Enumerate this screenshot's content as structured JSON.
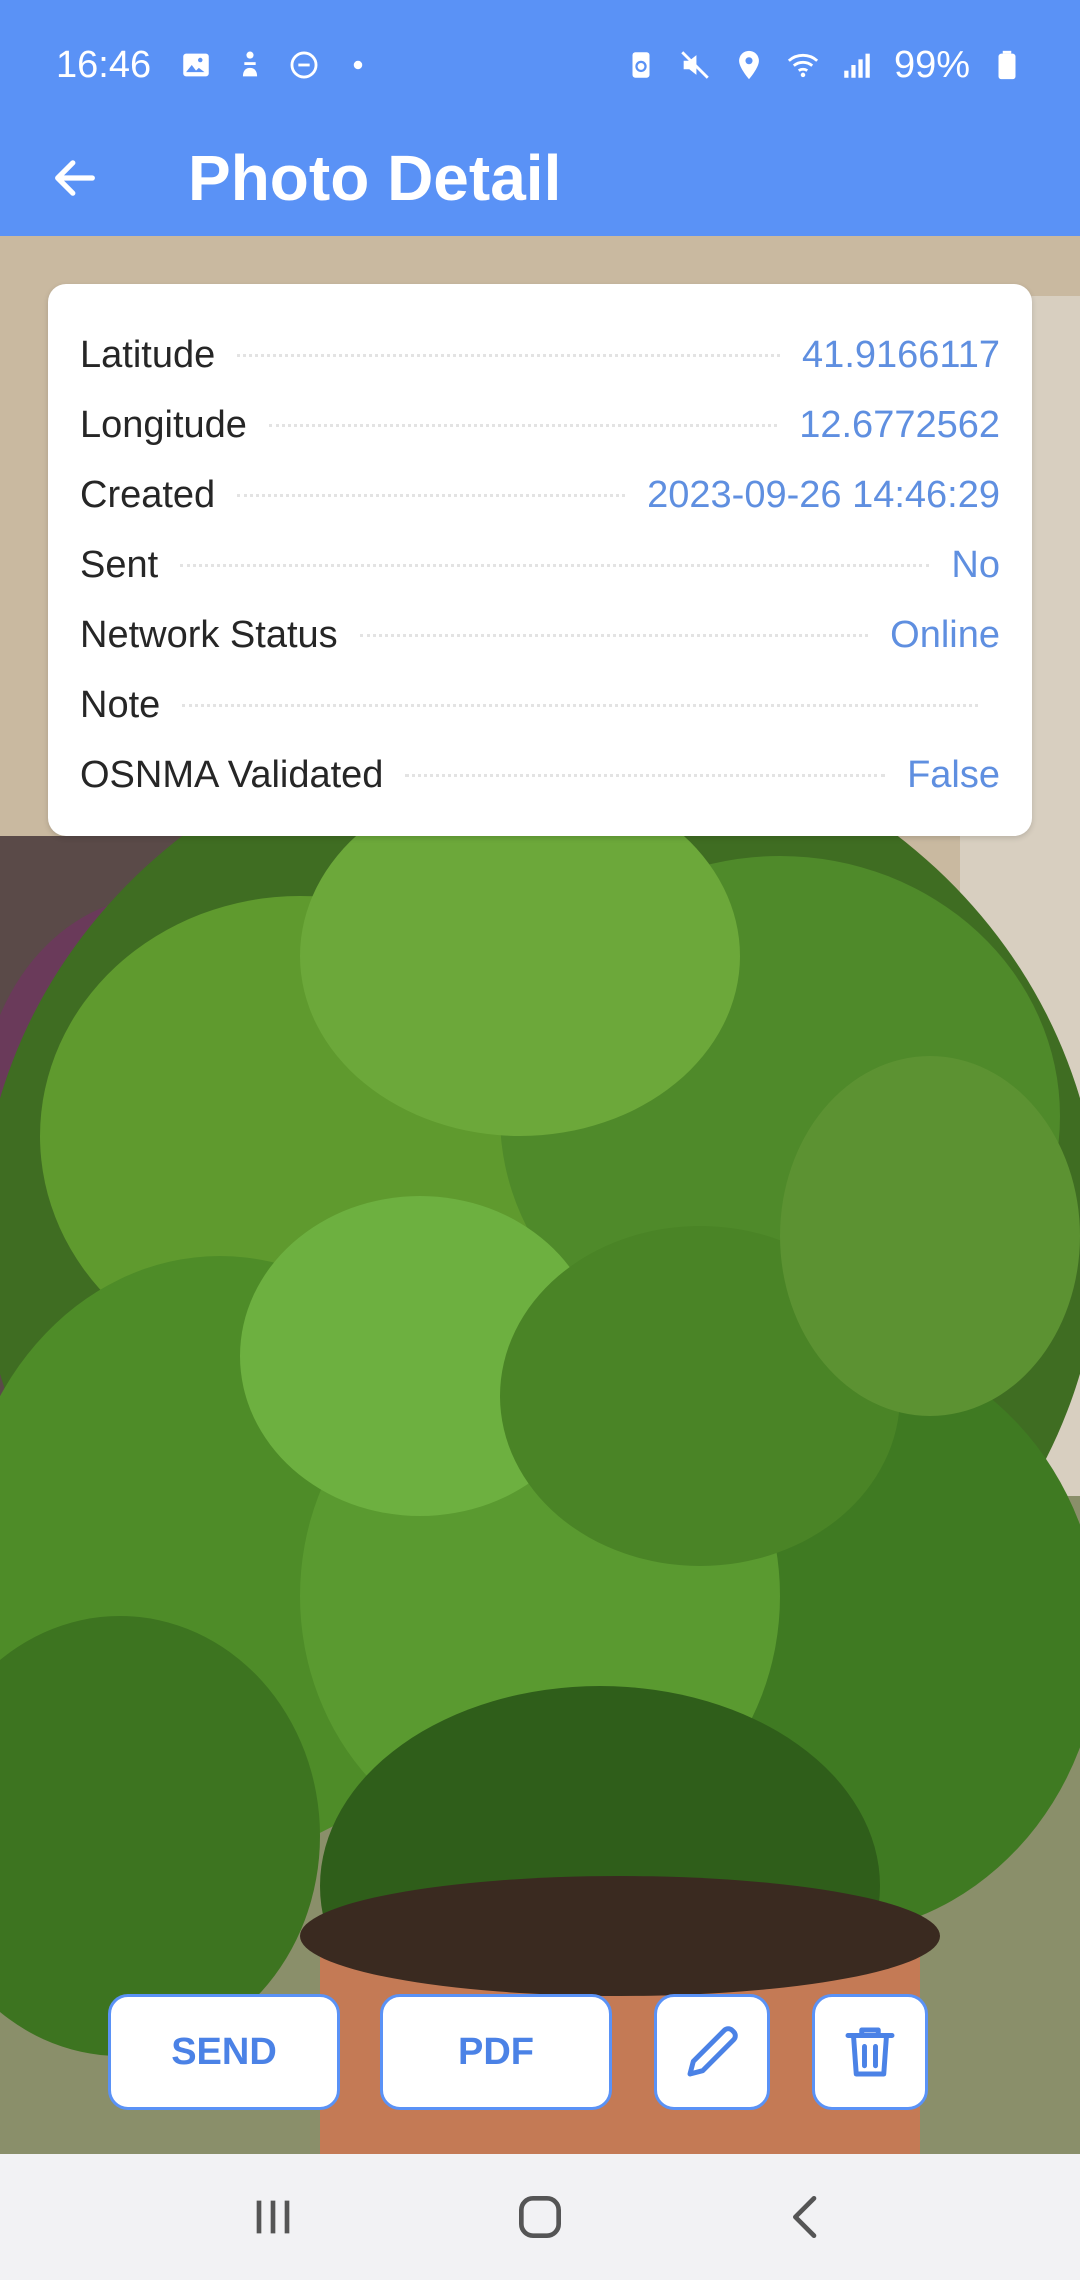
{
  "status_bar": {
    "time": "16:46",
    "battery": "99%",
    "icons_left": [
      "image-icon",
      "accessibility-icon",
      "do-not-disturb-icon",
      "dot-icon"
    ],
    "icons_right": [
      "recycle-battery-icon",
      "mute-icon",
      "location-icon",
      "wifi-icon",
      "signal-icon",
      "battery-icon"
    ]
  },
  "header": {
    "title": "Photo Detail",
    "back_icon": "arrow-left-icon",
    "background_color": "#5a92f6"
  },
  "details": [
    {
      "label": "Latitude",
      "value": "41.9166117"
    },
    {
      "label": "Longitude",
      "value": "12.6772562"
    },
    {
      "label": "Created",
      "value": "2023-09-26 14:46:29"
    },
    {
      "label": "Sent",
      "value": "No"
    },
    {
      "label": "Network Status",
      "value": "Online"
    },
    {
      "label": "Note",
      "value": ""
    },
    {
      "label": "OSNMA Validated",
      "value": "False"
    }
  ],
  "actions": {
    "send_label": "SEND",
    "pdf_label": "PDF",
    "edit_icon": "pencil-icon",
    "delete_icon": "trash-icon",
    "accent_color": "#5a92f6"
  },
  "nav": {
    "recents_icon": "recents-icon",
    "home_icon": "home-icon",
    "back_icon": "chevron-left-icon"
  }
}
